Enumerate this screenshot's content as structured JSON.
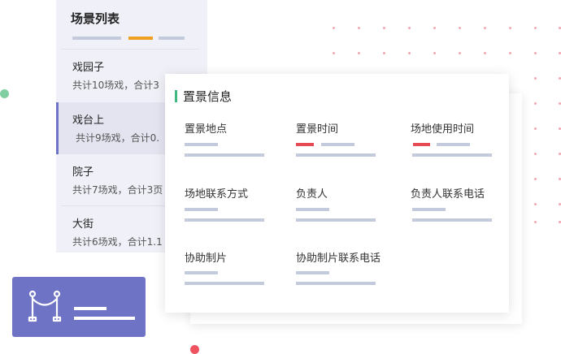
{
  "scene_list": {
    "title": "场景列表",
    "items": [
      {
        "name": "戏园子",
        "meta": "共计10场戏，合计3"
      },
      {
        "name": "戏台上",
        "meta": "共计9场戏，合计0."
      },
      {
        "name": "院子",
        "meta": "共计7场戏，合计3页"
      },
      {
        "name": "大街",
        "meta": "共计6场戏，合计1.1"
      }
    ],
    "active_index": 1
  },
  "scene_info": {
    "title": "置景信息",
    "fields": {
      "location": "置景地点",
      "time": "置景时间",
      "venue_time": "场地使用时间",
      "venue_contact": "场地联系方式",
      "manager": "负责人",
      "manager_phone": "负责人联系电话",
      "assist": "协助制片",
      "assist_phone": "协助制片联系电话"
    }
  },
  "colors": {
    "accent_purple": "#6f73c6",
    "accent_orange": "#f0a020",
    "accent_green": "#3fb97f",
    "accent_red": "#e64b55",
    "placeholder_bar": "#c3cadc"
  },
  "icons": {
    "queue_barrier": "stanchion-icon"
  }
}
